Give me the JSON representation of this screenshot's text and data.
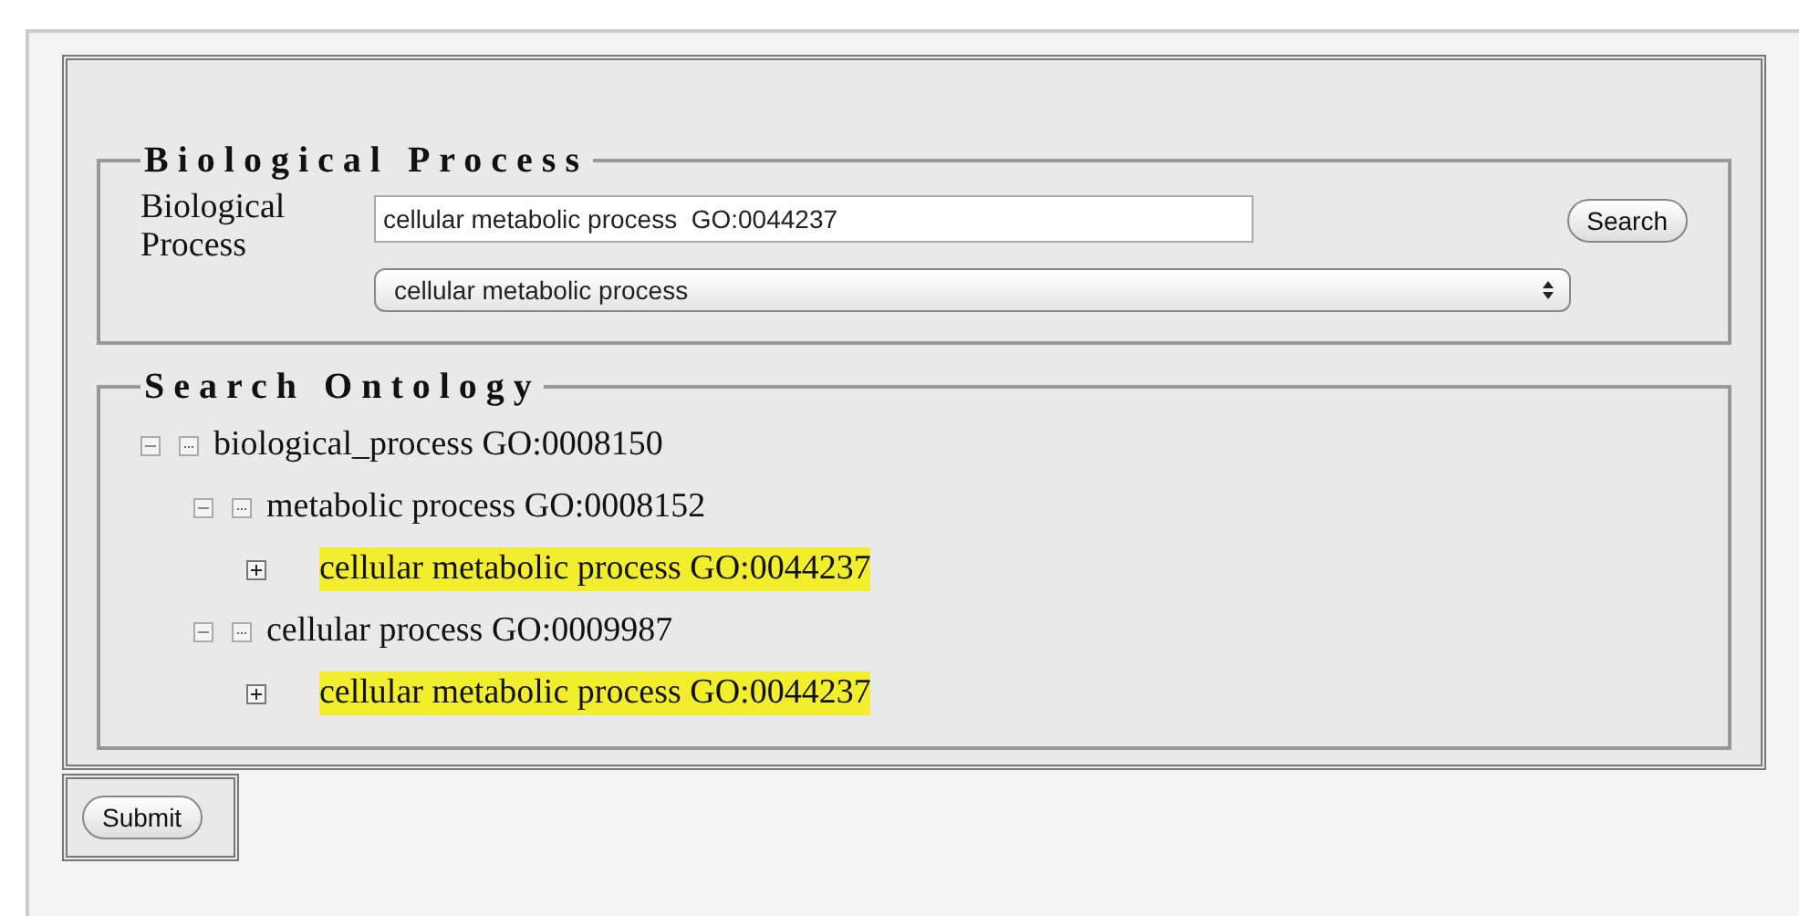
{
  "biological_process_section": {
    "legend": "Biological Process",
    "label": "Biological Process",
    "search_field": {
      "value": "cellular metabolic process  GO:0044237"
    },
    "search_button": "Search",
    "select": {
      "value": "cellular metabolic process"
    }
  },
  "ontology_section": {
    "legend": "Search Ontology",
    "tree": [
      {
        "label": "biological_process GO:0008150",
        "expanded": true,
        "highlighted": false,
        "children": [
          {
            "label": "metabolic process GO:0008152",
            "expanded": true,
            "highlighted": false,
            "children": [
              {
                "label": "cellular metabolic process GO:0044237",
                "expanded": false,
                "highlighted": true
              }
            ]
          },
          {
            "label": "cellular process GO:0009987",
            "expanded": true,
            "highlighted": false,
            "children": [
              {
                "label": "cellular metabolic process GO:0044237",
                "expanded": false,
                "highlighted": true
              }
            ]
          }
        ]
      }
    ]
  },
  "submit_button": "Submit"
}
